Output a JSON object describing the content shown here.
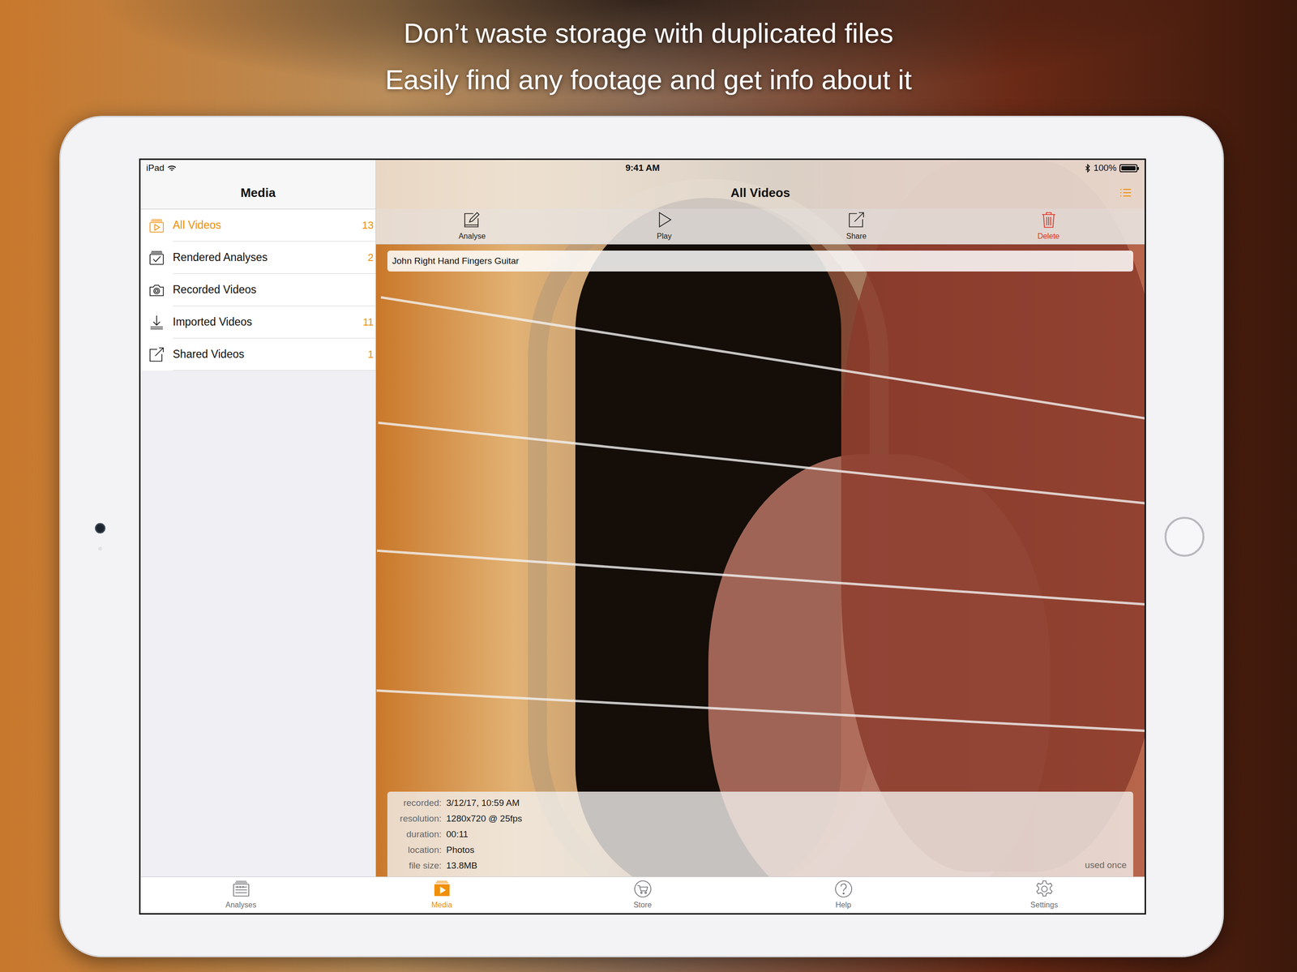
{
  "headline": [
    "Don’t waste storage with duplicated files",
    "Easily find any footage and get info about it"
  ],
  "status_bar": {
    "device": "iPad",
    "time": "9:41 AM",
    "battery": "100%"
  },
  "sidebar": {
    "title": "Media",
    "items": [
      {
        "label": "All Videos",
        "count": "13",
        "selected": true
      },
      {
        "label": "Rendered Analyses",
        "count": "2",
        "selected": false
      },
      {
        "label": "Recorded Videos",
        "count": "",
        "selected": false
      },
      {
        "label": "Imported Videos",
        "count": "11",
        "selected": false
      },
      {
        "label": "Shared Videos",
        "count": "1",
        "selected": false
      }
    ]
  },
  "main": {
    "title": "All Videos",
    "toolbar": [
      {
        "label": "Analyse",
        "destructive": false
      },
      {
        "label": "Play",
        "destructive": false
      },
      {
        "label": "Share",
        "destructive": false
      },
      {
        "label": "Delete",
        "destructive": true
      }
    ]
  },
  "video": {
    "name": "John Right Hand Fingers Guitar",
    "info": [
      {
        "label": "recorded:",
        "value": "3/12/17, 10:59 AM"
      },
      {
        "label": "resolution:",
        "value": "1280x720 @ 25fps"
      },
      {
        "label": "duration:",
        "value": "00:11"
      },
      {
        "label": "location:",
        "value": "Photos"
      },
      {
        "label": "file size:",
        "value": "13.8MB"
      }
    ],
    "usage": "used once"
  },
  "tab_bar": [
    {
      "label": "Analyses",
      "selected": false
    },
    {
      "label": "Media",
      "selected": true
    },
    {
      "label": "Store",
      "selected": false
    },
    {
      "label": "Help",
      "selected": false
    },
    {
      "label": "Settings",
      "selected": false
    }
  ]
}
